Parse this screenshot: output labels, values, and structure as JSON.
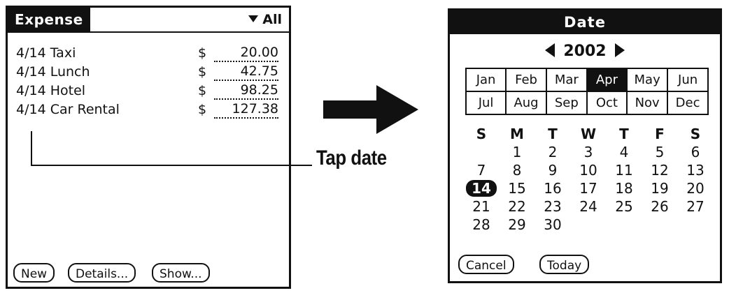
{
  "expense": {
    "title": "Expense",
    "category": "All",
    "items": [
      {
        "date": "4/14",
        "description": "Taxi",
        "currency": "$",
        "amount": "20.00"
      },
      {
        "date": "4/14",
        "description": "Lunch",
        "currency": "$",
        "amount": "42.75"
      },
      {
        "date": "4/14",
        "description": "Hotel",
        "currency": "$",
        "amount": "98.25"
      },
      {
        "date": "4/14",
        "description": "Car Rental",
        "currency": "$",
        "amount": "127.38"
      }
    ],
    "buttons": {
      "new": "New",
      "details": "Details...",
      "show": "Show..."
    }
  },
  "callout": {
    "label": "Tap date"
  },
  "date_dialog": {
    "title": "Date",
    "year": "2002",
    "months": [
      "Jan",
      "Feb",
      "Mar",
      "Apr",
      "May",
      "Jun",
      "Jul",
      "Aug",
      "Sep",
      "Oct",
      "Nov",
      "Dec"
    ],
    "selected_month": "Apr",
    "weekday_headers": [
      "S",
      "M",
      "T",
      "W",
      "T",
      "F",
      "S"
    ],
    "weeks": [
      [
        "",
        "1",
        "2",
        "3",
        "4",
        "5",
        "6"
      ],
      [
        "7",
        "8",
        "9",
        "10",
        "11",
        "12",
        "13"
      ],
      [
        "14",
        "15",
        "16",
        "17",
        "18",
        "19",
        "20"
      ],
      [
        "21",
        "22",
        "23",
        "24",
        "25",
        "26",
        "27"
      ],
      [
        "28",
        "29",
        "30",
        "",
        "",
        "",
        ""
      ]
    ],
    "selected_day": "14",
    "buttons": {
      "cancel": "Cancel",
      "today": "Today"
    }
  }
}
